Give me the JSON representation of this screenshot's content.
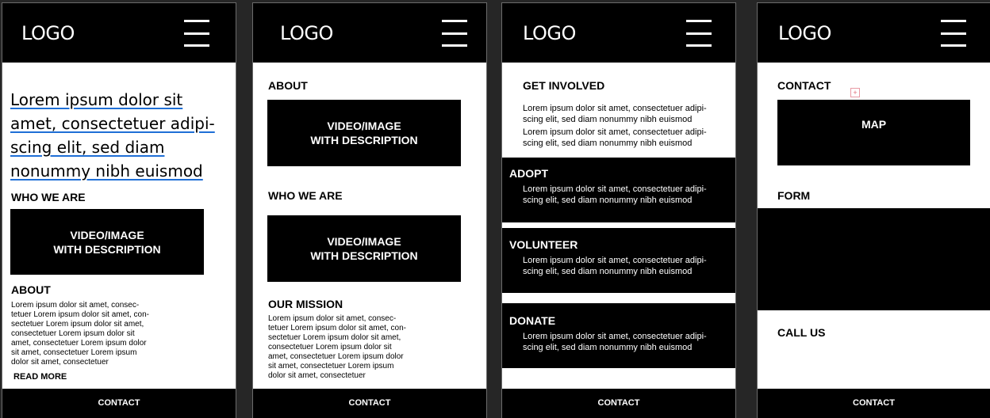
{
  "logo": "LOGO",
  "footer_label": "CONTACT",
  "screen1": {
    "hero_lines": [
      "Lorem ipsum dolor sit",
      "amet, consectetuer adipi-",
      "scing elit, sed diam",
      "nonummy nibh euismod"
    ],
    "who_we_are": "WHO WE ARE",
    "video_line1": "VIDEO/IMAGE",
    "video_line2": "WITH DESCRIPTION",
    "about": "ABOUT",
    "about_text": [
      "Lorem ipsum dolor sit amet, consec-",
      "tetuer Lorem ipsum dolor sit amet, con-",
      "sectetuer Lorem ipsum dolor sit amet,",
      "consectetuer Lorem ipsum dolor sit",
      "amet, consectetuer Lorem ipsum dolor",
      "sit amet, consectetuer Lorem ipsum",
      "dolor sit amet, consectetuer"
    ],
    "read_more": "READ MORE"
  },
  "screen2": {
    "about": "ABOUT",
    "video_line1": "VIDEO/IMAGE",
    "video_line2": "WITH DESCRIPTION",
    "who_we_are": "WHO WE ARE",
    "our_mission": "OUR MISSION",
    "mission_text": [
      "Lorem ipsum dolor sit amet, consec-",
      "tetuer Lorem ipsum dolor sit amet, con-",
      "sectetuer Lorem ipsum dolor sit amet,",
      "consectetuer Lorem ipsum dolor sit",
      "amet, consectetuer Lorem ipsum dolor",
      "sit amet, consectetuer Lorem ipsum",
      "dolor sit amet, consectetuer"
    ]
  },
  "screen3": {
    "get_involved": "GET INVOLVED",
    "line_a": "Lorem ipsum dolor sit amet, consectetuer adipi-",
    "line_b": "scing elit, sed diam nonummy nibh euismod",
    "adopt": "ADOPT",
    "volunteer": "VOLUNTEER",
    "donate": "DONATE"
  },
  "screen4": {
    "contact": "CONTACT",
    "map": "MAP",
    "form": "FORM",
    "call_us": "CALL US"
  }
}
